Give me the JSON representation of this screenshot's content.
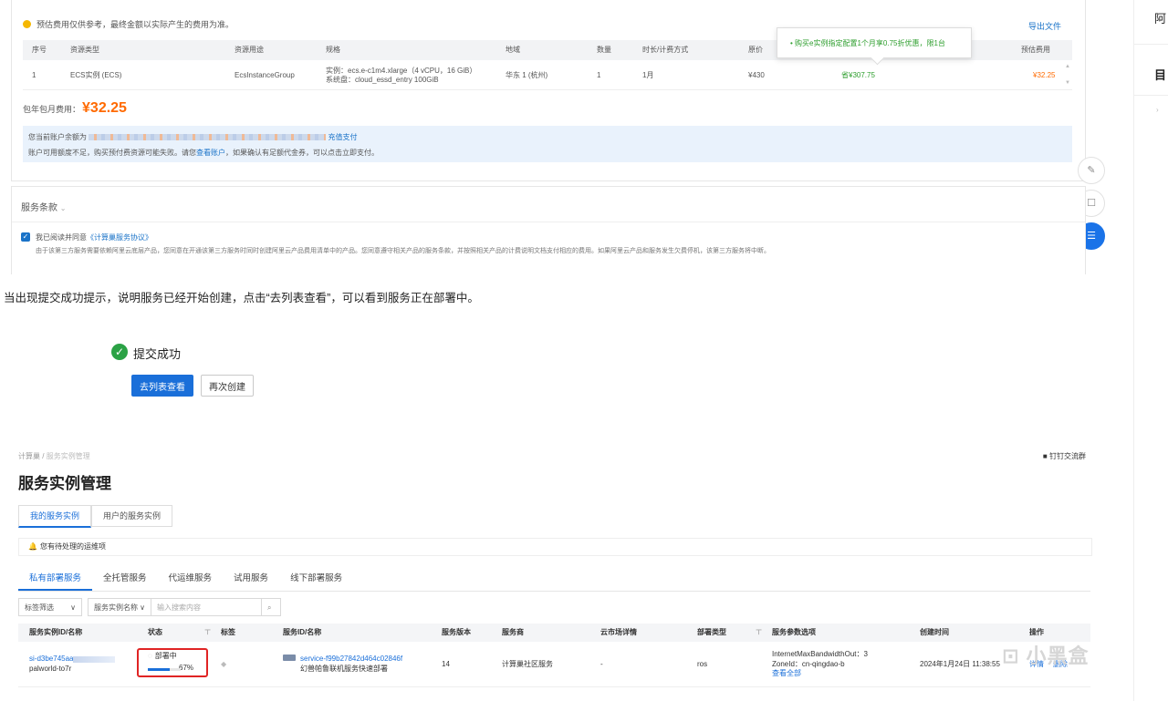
{
  "billing": {
    "notice": "预估费用仅供参考，最终金额以实际产生的费用为准。",
    "export_link": "导出文件",
    "columns": [
      "序号",
      "资源类型",
      "资源用途",
      "规格",
      "地域",
      "数量",
      "时长/计费方式",
      "原价",
      "",
      "预估费用"
    ],
    "row": {
      "index": "1",
      "type": "ECS实例 (ECS)",
      "usage": "EcsInstanceGroup",
      "spec_line1": "实例：ecs.e-c1m4.xlarge（4 vCPU，16 GiB）",
      "spec_line2": "系统盘：cloud_essd_entry 100GiB",
      "region": "华东 1 (杭州)",
      "qty": "1",
      "duration": "1月",
      "orig_price": "¥430",
      "discount_price": "省¥307.75",
      "est_price": "¥32.25"
    },
    "tooltip": "• 购买e实例指定配置1个月享0.75折优惠，限1台",
    "total_label": "包年包月费用：",
    "total_amount": "¥32.25",
    "balance_line1_prefix": "您当前账户余额为",
    "balance_line1_link": "充值支付",
    "balance_line2_a": "账户可用额度不足，购买预付费资源可能失败。请您",
    "balance_line2_link": "查看账户",
    "balance_line2_b": "，如果确认有足额代金券，可以点击立即支付。"
  },
  "terms": {
    "title": "服务条款",
    "agree_prefix": "我已阅读并同意",
    "agree_link": "《计算巢服务协议》",
    "desc": "由于该第三方服务需要依赖阿里云底层产品，您同意在开通该第三方服务时同时创建阿里云产品费用清单中的产品。您同意遵守相关产品的服务条款，并按照相关产品的计费说明文档支付相应的费用。如果阿里云产品和服务发生欠费停机，该第三方服务将中断。"
  },
  "right_strip": {
    "top_text": "阿",
    "heading": "目"
  },
  "caption": "当出现提交成功提示，说明服务已经开始创建，点击“去列表查看”，可以看到服务正在部署中。",
  "submit": {
    "success_text": "提交成功",
    "view_list_button": "去列表查看",
    "create_again_button": "再次创建"
  },
  "instances": {
    "breadcrumb_root": "计算巢",
    "breadcrumb_sep": "/",
    "breadcrumb_current": "服务实例管理",
    "dingtalk": "钉钉交流群",
    "page_title": "服务实例管理",
    "tabs": [
      "我的服务实例",
      "用户的服务实例"
    ],
    "alert": "您有待处理的运维项",
    "sub_tabs": [
      "私有部署服务",
      "全托管服务",
      "代运维服务",
      "试用服务",
      "线下部署服务"
    ],
    "filter_tag": "标签筛选",
    "filter_name": "服务实例名称",
    "search_placeholder": "输入搜索内容",
    "columns": [
      "服务实例ID/名称",
      "状态",
      "标签",
      "服务ID/名称",
      "服务版本",
      "服务商",
      "云市场详情",
      "部署类型",
      "服务参数选项",
      "创建时间",
      "操作"
    ],
    "row": {
      "id": "si-d3be745aa",
      "name": "palworld-to7r",
      "status": "部署中",
      "progress_text": "67%",
      "progress": 0.67,
      "service_id": "service-f99b27842d464c02846f",
      "service_name": "幻兽帕鲁联机服务快速部署",
      "version": "14",
      "provider": "计算巢社区服务",
      "market": "-",
      "deploy_type": "ros",
      "param1": "InternetMaxBandwidthOut：3",
      "param2": "ZoneId：cn-qingdao-b",
      "param_more": "查看全部",
      "created": "2024年1月24日 11:38:55",
      "action_detail": "详情",
      "action_delete": "删除"
    }
  },
  "watermark": "小黑盒",
  "colors": {
    "primary": "#1a6fd9",
    "price": "#ff6a00",
    "success": "#2ba245",
    "highlight": "#e02424"
  }
}
